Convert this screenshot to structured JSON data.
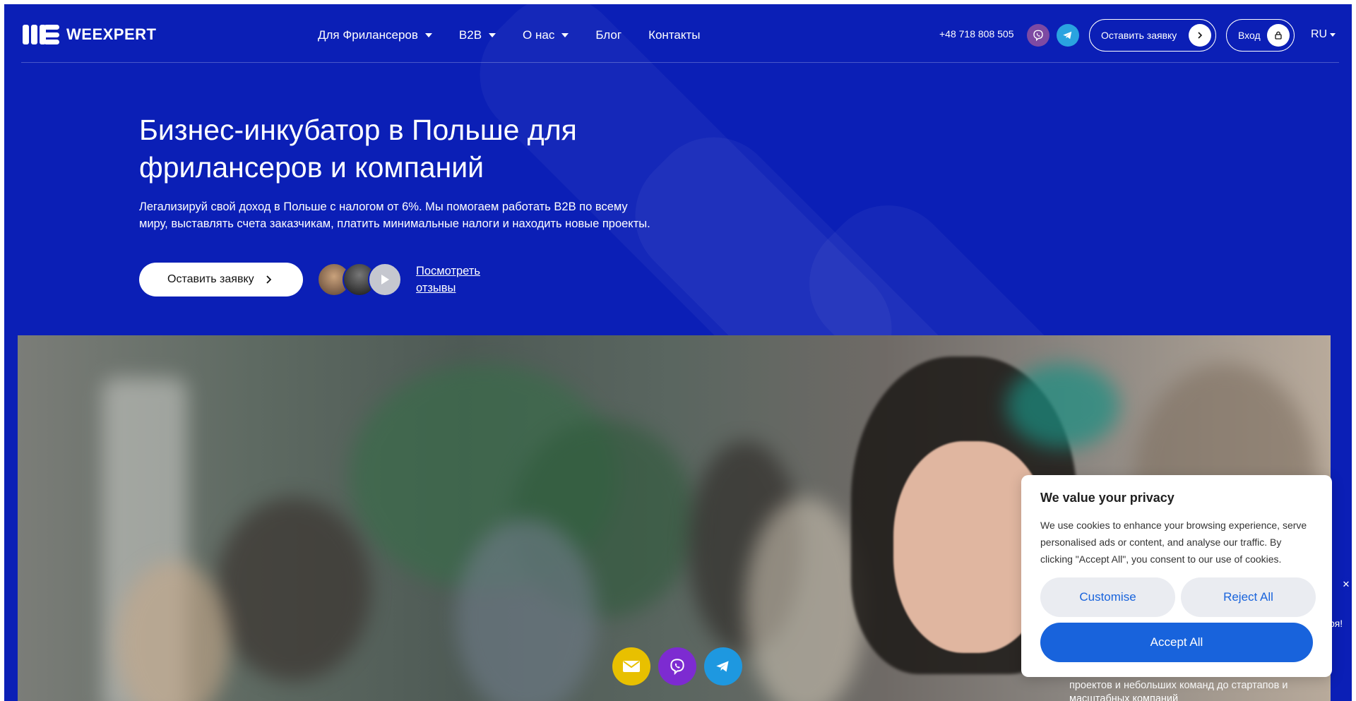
{
  "brand": {
    "name": "WEEXPERT"
  },
  "nav": {
    "items": [
      {
        "label": "Для Фриланcеров",
        "has_dropdown": true
      },
      {
        "label": "B2B",
        "has_dropdown": true
      },
      {
        "label": "О нас",
        "has_dropdown": true
      },
      {
        "label": "Блог",
        "has_dropdown": false
      },
      {
        "label": "Контакты",
        "has_dropdown": false
      }
    ]
  },
  "header": {
    "phone": "+48 718 808 505",
    "viber_icon": "viber-icon",
    "telegram_icon": "telegram-icon",
    "request_button": "Оставить заявку",
    "login_button": "Вход",
    "language": "RU"
  },
  "hero": {
    "title": "Бизнес-инкубатор в Польше для фрилансеров и компаний",
    "description": "Легализируй свой доход в Польше с налогом от 6%. Мы помогаем работать B2B по всему миру, выставлять счета заказчикам, платить минимальные налоги и находить новые проекты.",
    "cta": "Оставить заявку",
    "reviews_link": "Посмотреть отзывы"
  },
  "floating_contacts": [
    "email-icon",
    "viber-icon",
    "telegram-icon"
  ],
  "behind_text": {
    "fragment": "развития вашего бизнеса — от фрилансе проектов и небольших команд до стартапов и масштабных компаний",
    "side_fragment": "ря!"
  },
  "cookie": {
    "title": "We value your privacy",
    "text": "We use cookies to enhance your browsing experience, serve personalised ads or content, and analyse our traffic. By clicking \"Accept All\", you consent to our use of cookies.",
    "customise": "Customise",
    "reject": "Reject All",
    "accept": "Accept All"
  },
  "colors": {
    "background": "#0b1fb6",
    "accept": "#1863dc",
    "viber": "#7d4aa3",
    "telegram": "#2aa3e0",
    "email": "#e8c000"
  }
}
